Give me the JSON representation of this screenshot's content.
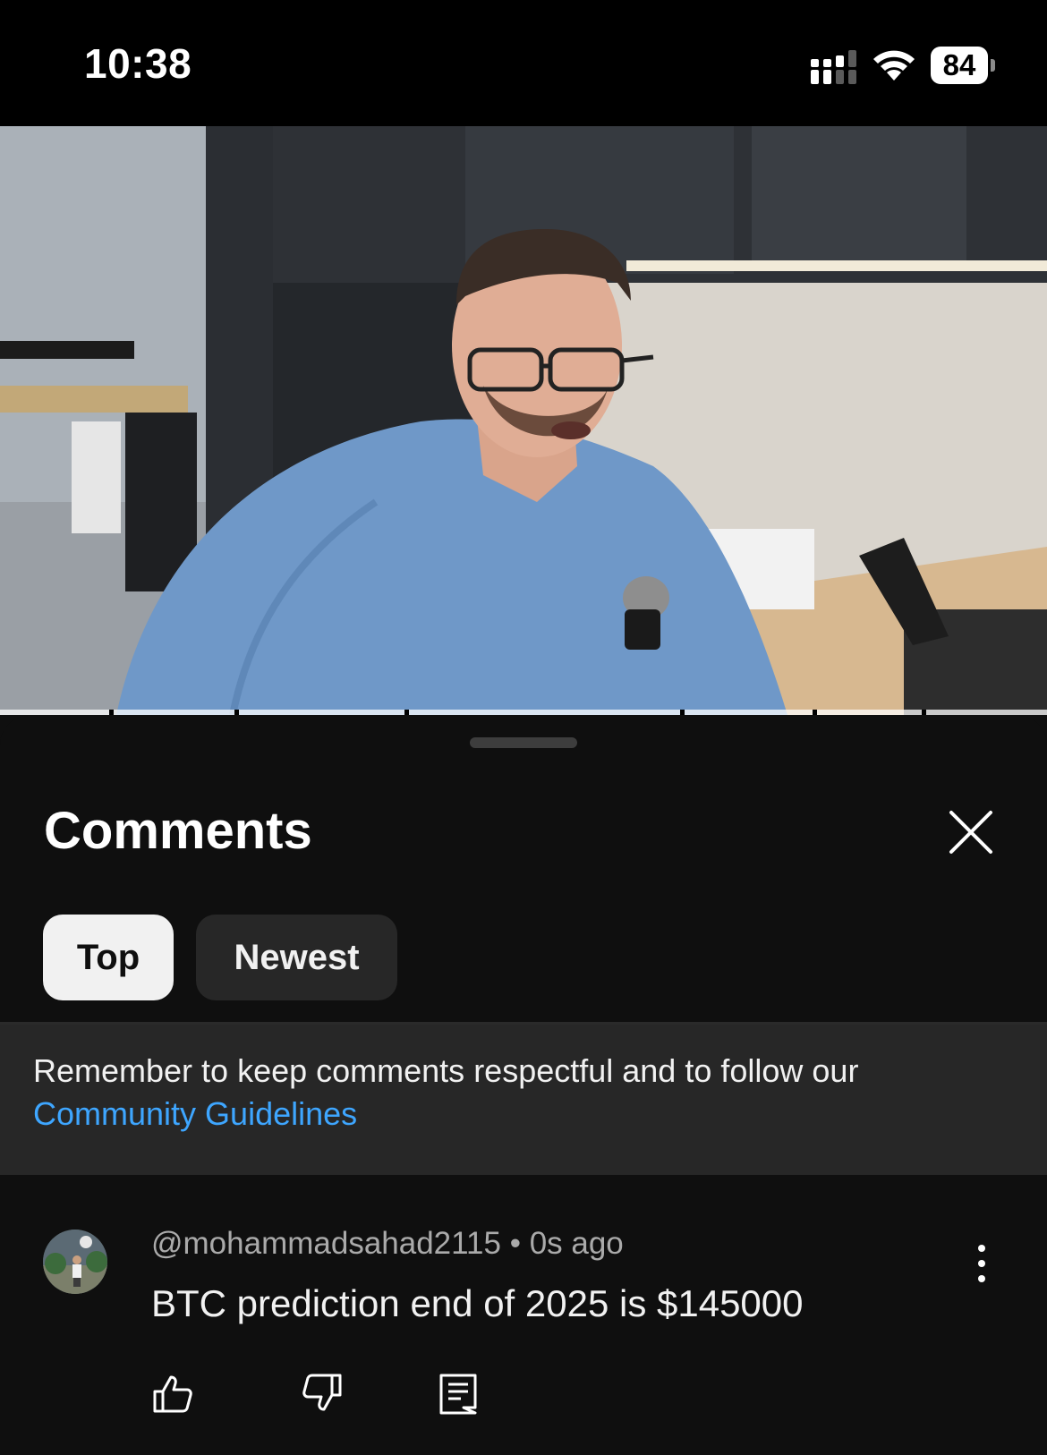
{
  "status_bar": {
    "time": "10:38",
    "battery": "84",
    "icons": [
      "cellular-signal-icon",
      "wifi-icon",
      "battery-icon"
    ]
  },
  "video": {
    "description_icon": "video-player"
  },
  "comments_panel": {
    "title": "Comments",
    "close_icon": "close-icon",
    "sort_chips": [
      {
        "label": "Top",
        "selected": true
      },
      {
        "label": "Newest",
        "selected": false
      }
    ],
    "guidelines": {
      "text": "Remember to keep comments respectful and to follow our",
      "link": "Community Guidelines"
    },
    "comments": [
      {
        "author": "@mohammadsahad2115",
        "separator": "•",
        "time": "0s ago",
        "text": "BTC prediction end of 2025 is $145000",
        "actions": [
          "like-icon",
          "dislike-icon",
          "reply-icon"
        ]
      }
    ]
  },
  "colors": {
    "background": "#0f0f0f",
    "chip_selected": "#f1f1f1",
    "chip_unselected": "#272727",
    "link": "#3ea6ff",
    "secondary_text": "#aaaaaa"
  }
}
